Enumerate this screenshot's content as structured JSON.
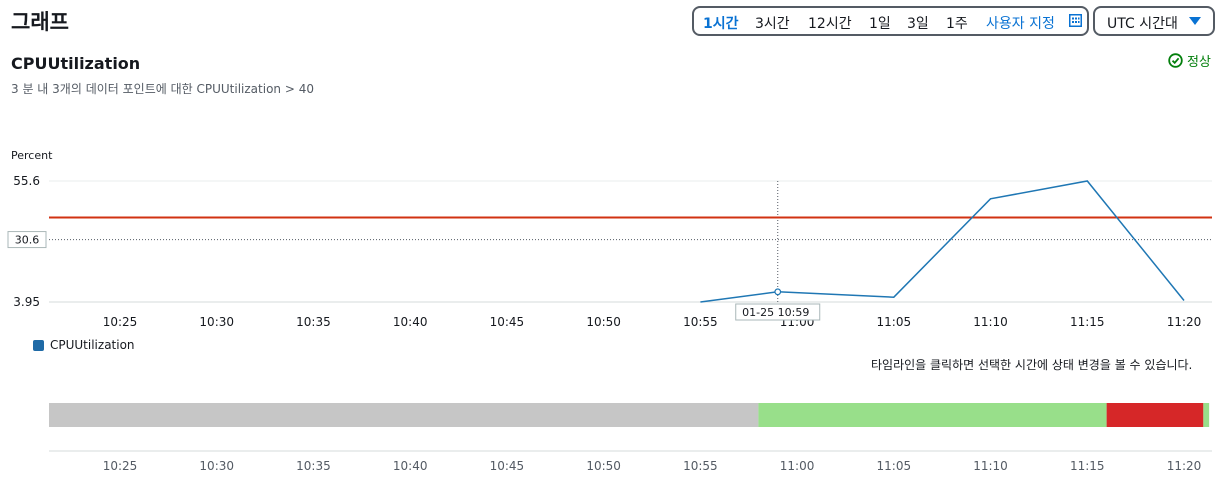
{
  "header": {
    "title": "그래프",
    "time_ranges": [
      {
        "label": "1시간",
        "active": true
      },
      {
        "label": "3시간",
        "active": false
      },
      {
        "label": "12시간",
        "active": false
      },
      {
        "label": "1일",
        "active": false
      },
      {
        "label": "3일",
        "active": false
      },
      {
        "label": "1주",
        "active": false
      }
    ],
    "custom_label": "사용자 지정",
    "custom_icon": "calendar-icon",
    "timezone_label": "UTC 시간대",
    "timezone_icon": "caret-down-icon"
  },
  "metric": {
    "name": "CPUUtilization",
    "description": "3 분 내 3개의 데이터 포인트에 대한 CPUUtilization > 40",
    "status": "정상",
    "status_icon": "check-circle-icon",
    "status_color": "#037f0c"
  },
  "chart_data": {
    "type": "line",
    "ylabel": "Percent",
    "y_ticks": [
      "55.6",
      "3.95"
    ],
    "ylim": [
      3.95,
      55.6
    ],
    "hover_value": "30.6",
    "hover_time": "01-25 10:59",
    "threshold": 40,
    "threshold_color": "#d13212",
    "x_tick_labels": [
      "10:25",
      "10:30",
      "10:35",
      "10:40",
      "10:45",
      "10:50",
      "10:55",
      "11:00",
      "11:05",
      "11:10",
      "11:15",
      "11:20"
    ],
    "series": [
      {
        "name": "CPUUtilization",
        "color": "#1f77b4",
        "x": [
          "10:55",
          "10:59",
          "11:05",
          "11:10",
          "11:15",
          "11:20"
        ],
        "y": [
          3.95,
          8.3,
          6.0,
          48.0,
          55.6,
          4.6
        ]
      }
    ]
  },
  "legend": {
    "label": "CPUUtilization",
    "color": "#1f6aa6"
  },
  "timeline": {
    "hint": "타임라인을 클릭하면 선택한 시간에 상태 변경을 볼 수 있습니다.",
    "segments": [
      {
        "state": "insufficient-data",
        "start": "10:21",
        "end": "10:58",
        "color": "#c6c6c6"
      },
      {
        "state": "ok",
        "start": "10:58",
        "end": "11:16",
        "color": "#98df8a"
      },
      {
        "state": "alarm",
        "start": "11:16",
        "end": "11:21",
        "color": "#d62728"
      },
      {
        "state": "ok",
        "start": "11:21",
        "end": "11:21.3",
        "color": "#98df8a"
      }
    ],
    "x_tick_labels": [
      "10:25",
      "10:30",
      "10:35",
      "10:40",
      "10:45",
      "10:50",
      "10:55",
      "11:00",
      "11:05",
      "11:10",
      "11:15",
      "11:20"
    ]
  }
}
